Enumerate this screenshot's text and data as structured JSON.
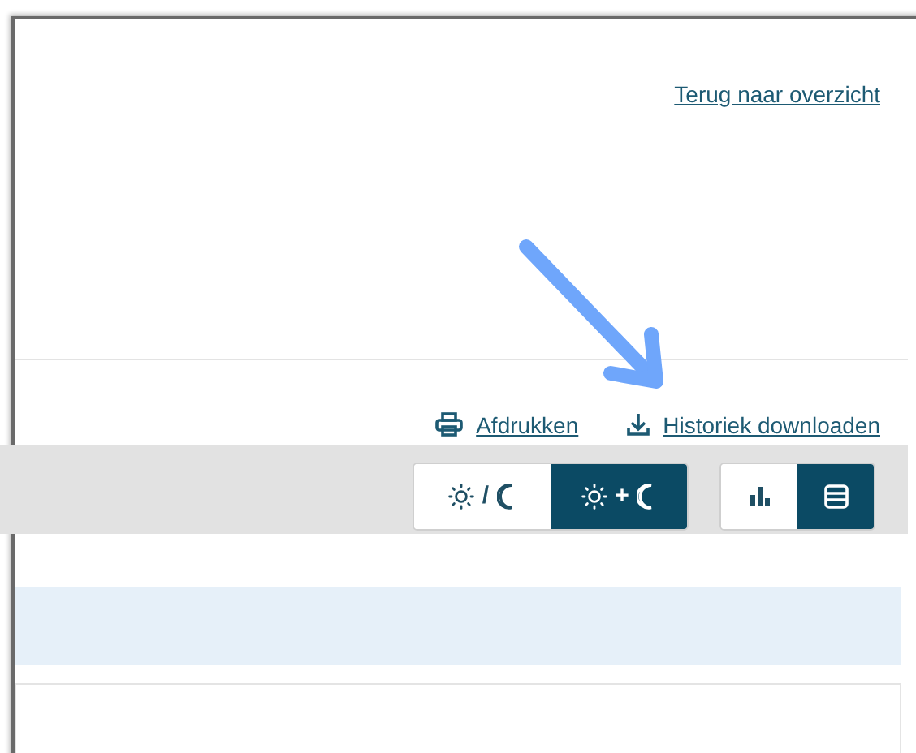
{
  "back_link": "Terug naar overzicht",
  "actions": [
    {
      "kind": "print",
      "label": "Afdrukken"
    },
    {
      "kind": "download",
      "label": "Historiek downloaden"
    }
  ],
  "toggles": [
    {
      "kind": "daynight",
      "options": [
        {
          "separator": "/",
          "selected": false
        },
        {
          "separator": "+",
          "selected": true
        }
      ]
    },
    {
      "kind": "view",
      "options": [
        {
          "kind": "chart",
          "selected": false
        },
        {
          "kind": "list",
          "selected": true
        }
      ]
    }
  ]
}
